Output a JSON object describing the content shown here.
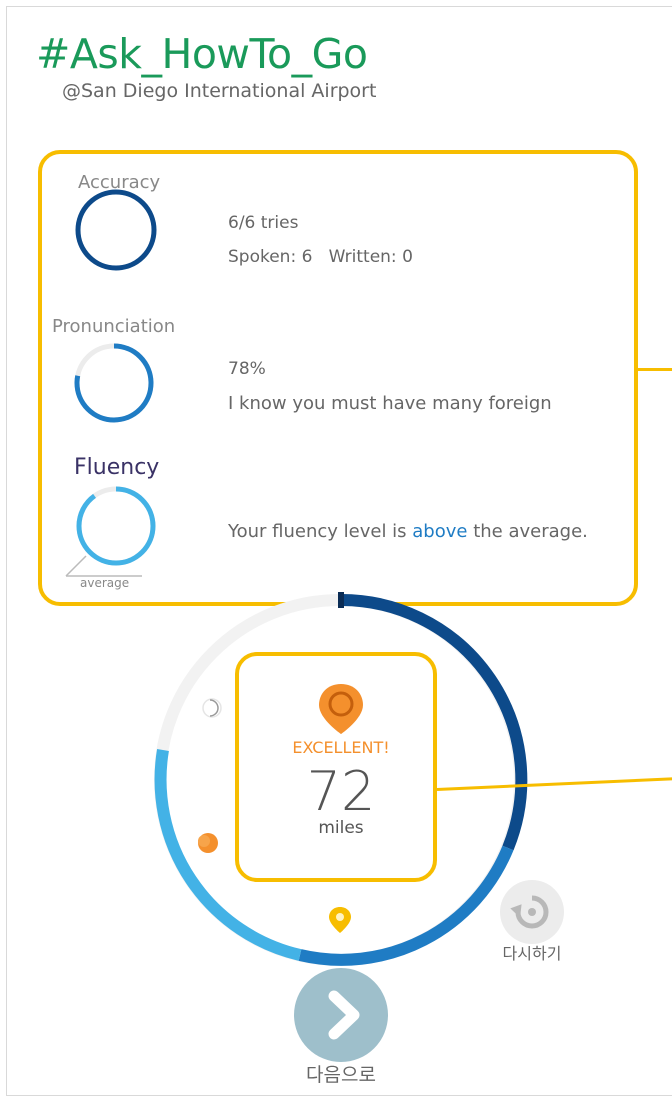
{
  "header": {
    "title": "#Ask_HowTo_Go",
    "location": "@San Diego International Airport"
  },
  "stats": {
    "accuracy": {
      "label": "Accuracy",
      "tries": "6/6 tries",
      "detail": "Spoken: 6   Written: 0",
      "progress": 1.0
    },
    "pronunciation": {
      "label": "Pronunciation",
      "percent": "78%",
      "sentence": "I know you must have many foreign",
      "progress": 0.78
    },
    "fluency": {
      "label": "Fluency",
      "sentence_before": "Your fluency level is ",
      "sentence_highlight": "above",
      "sentence_after": " the average.",
      "baseline_label": "average",
      "progress": 0.9
    }
  },
  "result": {
    "badge": "EXCELLENT!",
    "score": "72",
    "unit": "miles"
  },
  "buttons": {
    "retry_label": "다시하기",
    "next_label": "다음으로"
  },
  "colors": {
    "title_green": "#1a9a5a",
    "highlight_yellow": "#f7bd00",
    "accent_orange": "#f4902d",
    "dark_blue": "#0d4a8a",
    "mid_blue": "#1f7cc4",
    "light_blue": "#43b2e6"
  },
  "icons": {
    "retry": "refresh-icon",
    "next": "chevron-right-icon",
    "marker": "location-pin-icon"
  }
}
